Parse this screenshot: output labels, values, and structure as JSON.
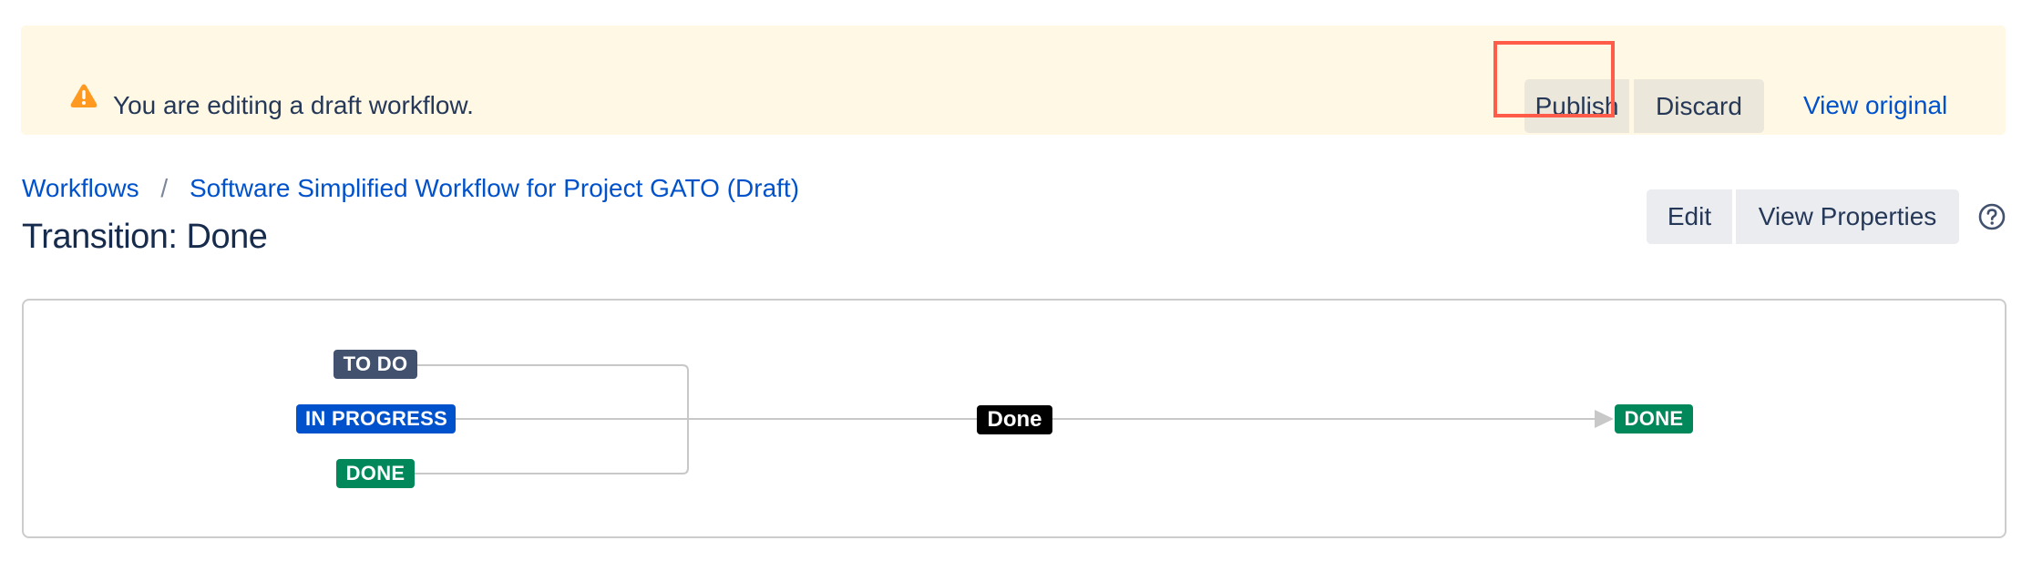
{
  "banner": {
    "icon": "warning-icon",
    "message": "You are editing a draft workflow.",
    "publish_label": "Publish",
    "discard_label": "Discard",
    "view_original_label": "View original",
    "colors": {
      "background": "#FFF8E5",
      "icon": "#FF991F",
      "highlight": "#FF5C49"
    }
  },
  "breadcrumb": {
    "items": [
      "Workflows",
      "Software Simplified Workflow for Project GATO (Draft)"
    ],
    "separator": "/"
  },
  "header": {
    "title": "Transition: Done",
    "edit_label": "Edit",
    "view_properties_label": "View Properties",
    "help_icon": "help-icon"
  },
  "diagram": {
    "source_statuses": [
      {
        "label": "TO DO",
        "color": "#42526E"
      },
      {
        "label": "IN PROGRESS",
        "color": "#0052CC"
      },
      {
        "label": "DONE",
        "color": "#00875A"
      }
    ],
    "transition": {
      "label": "Done",
      "color": "#000000"
    },
    "target_status": {
      "label": "DONE",
      "color": "#00875A"
    }
  }
}
